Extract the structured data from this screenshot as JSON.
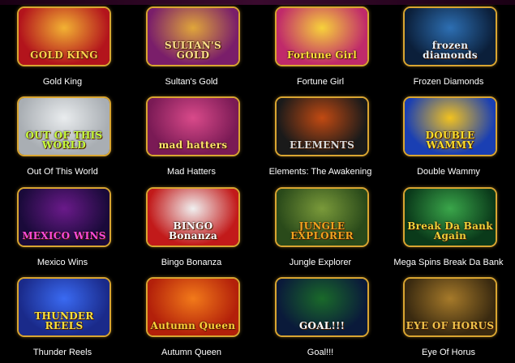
{
  "games": [
    {
      "title": "Gold King",
      "logo": "GOLD KING",
      "bg": "#b3141c",
      "bg2": "#f2b233",
      "logo_color": "#ffd34d"
    },
    {
      "title": "Sultan's Gold",
      "logo": "SULTAN'S GOLD",
      "bg": "#7a1e6a",
      "bg2": "#e0a63a",
      "logo_color": "#ffe08a"
    },
    {
      "title": "Fortune Girl",
      "logo": "Fortune Girl",
      "bg": "#c02a6a",
      "bg2": "#f7d23b",
      "logo_color": "#ffdf3a"
    },
    {
      "title": "Frozen Diamonds",
      "logo": "frozen diamonds",
      "bg": "#0b1f3a",
      "bg2": "#2d6fb3",
      "logo_color": "#e6f3ff"
    },
    {
      "title": "Out Of This World",
      "logo": "OUT OF THIS WORLD",
      "bg": "#a9aeb3",
      "bg2": "#e9ecee",
      "logo_color": "#c8ff3a"
    },
    {
      "title": "Mad Hatters",
      "logo": "mad hatters",
      "bg": "#7a1a55",
      "bg2": "#d94a8a",
      "logo_color": "#ffe56b"
    },
    {
      "title": "Elements: The Awakening",
      "logo": "ELEMENTS",
      "bg": "#1a1a1a",
      "bg2": "#c24a12",
      "logo_color": "#d9d9d9"
    },
    {
      "title": "Double Wammy",
      "logo": "DOUBLE WAMMY",
      "bg": "#1a3fb3",
      "bg2": "#f2c21f",
      "logo_color": "#ffdf2a"
    },
    {
      "title": "Mexico Wins",
      "logo": "MEXICO WINS",
      "bg": "#1a0a3a",
      "bg2": "#6a1a8a",
      "logo_color": "#ff4ad9"
    },
    {
      "title": "Bingo Bonanza",
      "logo": "BINGO Bonanza",
      "bg": "#c21a1a",
      "bg2": "#f0f0f0",
      "logo_color": "#ffffff"
    },
    {
      "title": "Jungle Explorer",
      "logo": "JUNGLE EXPLORER",
      "bg": "#2a4a1a",
      "bg2": "#7a9a3a",
      "logo_color": "#f2a21f"
    },
    {
      "title": "Mega Spins Break Da Bank",
      "logo": "Break Da Bank Again",
      "bg": "#0a3a1a",
      "bg2": "#3aa64a",
      "logo_color": "#f2d23a"
    },
    {
      "title": "Thunder Reels",
      "logo": "THUNDER REELS",
      "bg": "#1a2a8a",
      "bg2": "#3a6af2",
      "logo_color": "#ffe23a"
    },
    {
      "title": "Autumn Queen",
      "logo": "Autumn Queen",
      "bg": "#b3200a",
      "bg2": "#f27a1a",
      "logo_color": "#ffd23a"
    },
    {
      "title": "Goal!!!",
      "logo": "GOAL!!!",
      "bg": "#0a1a3a",
      "bg2": "#1a6a2a",
      "logo_color": "#ffffff"
    },
    {
      "title": "Eye Of Horus",
      "logo": "EYE OF HORUS",
      "bg": "#3a2a10",
      "bg2": "#a67a2a",
      "logo_color": "#f2c24a"
    }
  ]
}
